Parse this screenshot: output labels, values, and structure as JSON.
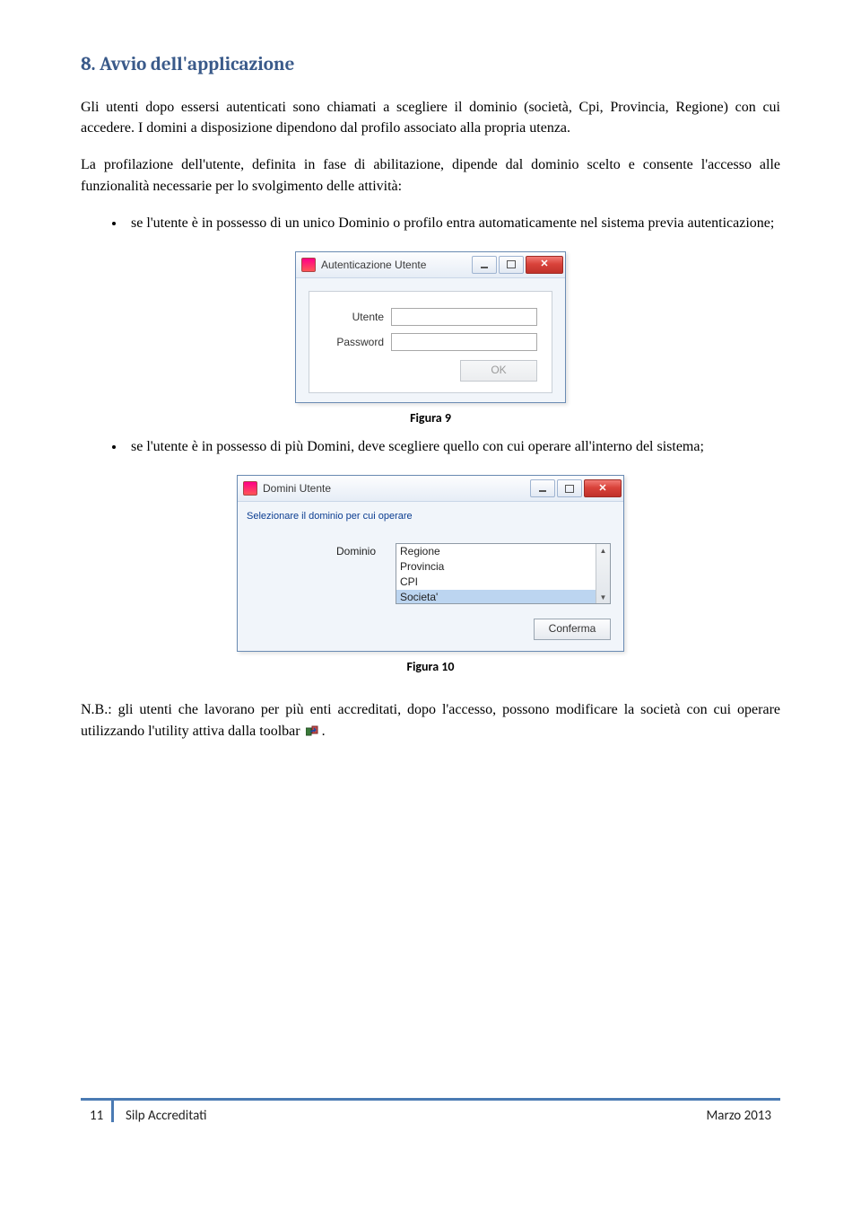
{
  "section": {
    "title": "8. Avvio dell'applicazione",
    "para1": "Gli utenti dopo essersi autenticati sono chiamati a scegliere il dominio (società, Cpi, Provincia, Regione) con cui accedere. I domini a disposizione dipendono dal profilo associato alla propria utenza.",
    "para2": "La profilazione dell'utente, definita in fase di abilitazione, dipende dal dominio scelto e consente l'accesso alle funzionalità necessarie per lo svolgimento delle attività:",
    "bullet1": "se l'utente è in possesso di un unico Dominio o profilo entra automaticamente nel sistema previa autenticazione;",
    "bullet2": "se l'utente è in possesso di più Domini, deve scegliere quello con cui operare all'interno del sistema;",
    "note_prefix": "N.B.: gli utenti che lavorano per più enti accreditati, dopo l'accesso, possono modificare la società con cui operare utilizzando l'utility attiva dalla toolbar",
    "note_suffix": "."
  },
  "dialog1": {
    "title": "Autenticazione Utente",
    "label_user": "Utente",
    "label_pass": "Password",
    "ok": "OK"
  },
  "dialog2": {
    "title": "Domini Utente",
    "instruction": "Selezionare il dominio per cui operare",
    "label_domain": "Dominio",
    "options": [
      "Regione",
      "Provincia",
      "CPI",
      "Societa'"
    ],
    "confirm": "Conferma"
  },
  "captions": {
    "fig9": "Figura 9",
    "fig10": "Figura 10"
  },
  "footer": {
    "page": "11",
    "doc": "Silp Accreditati",
    "date": "Marzo 2013"
  }
}
